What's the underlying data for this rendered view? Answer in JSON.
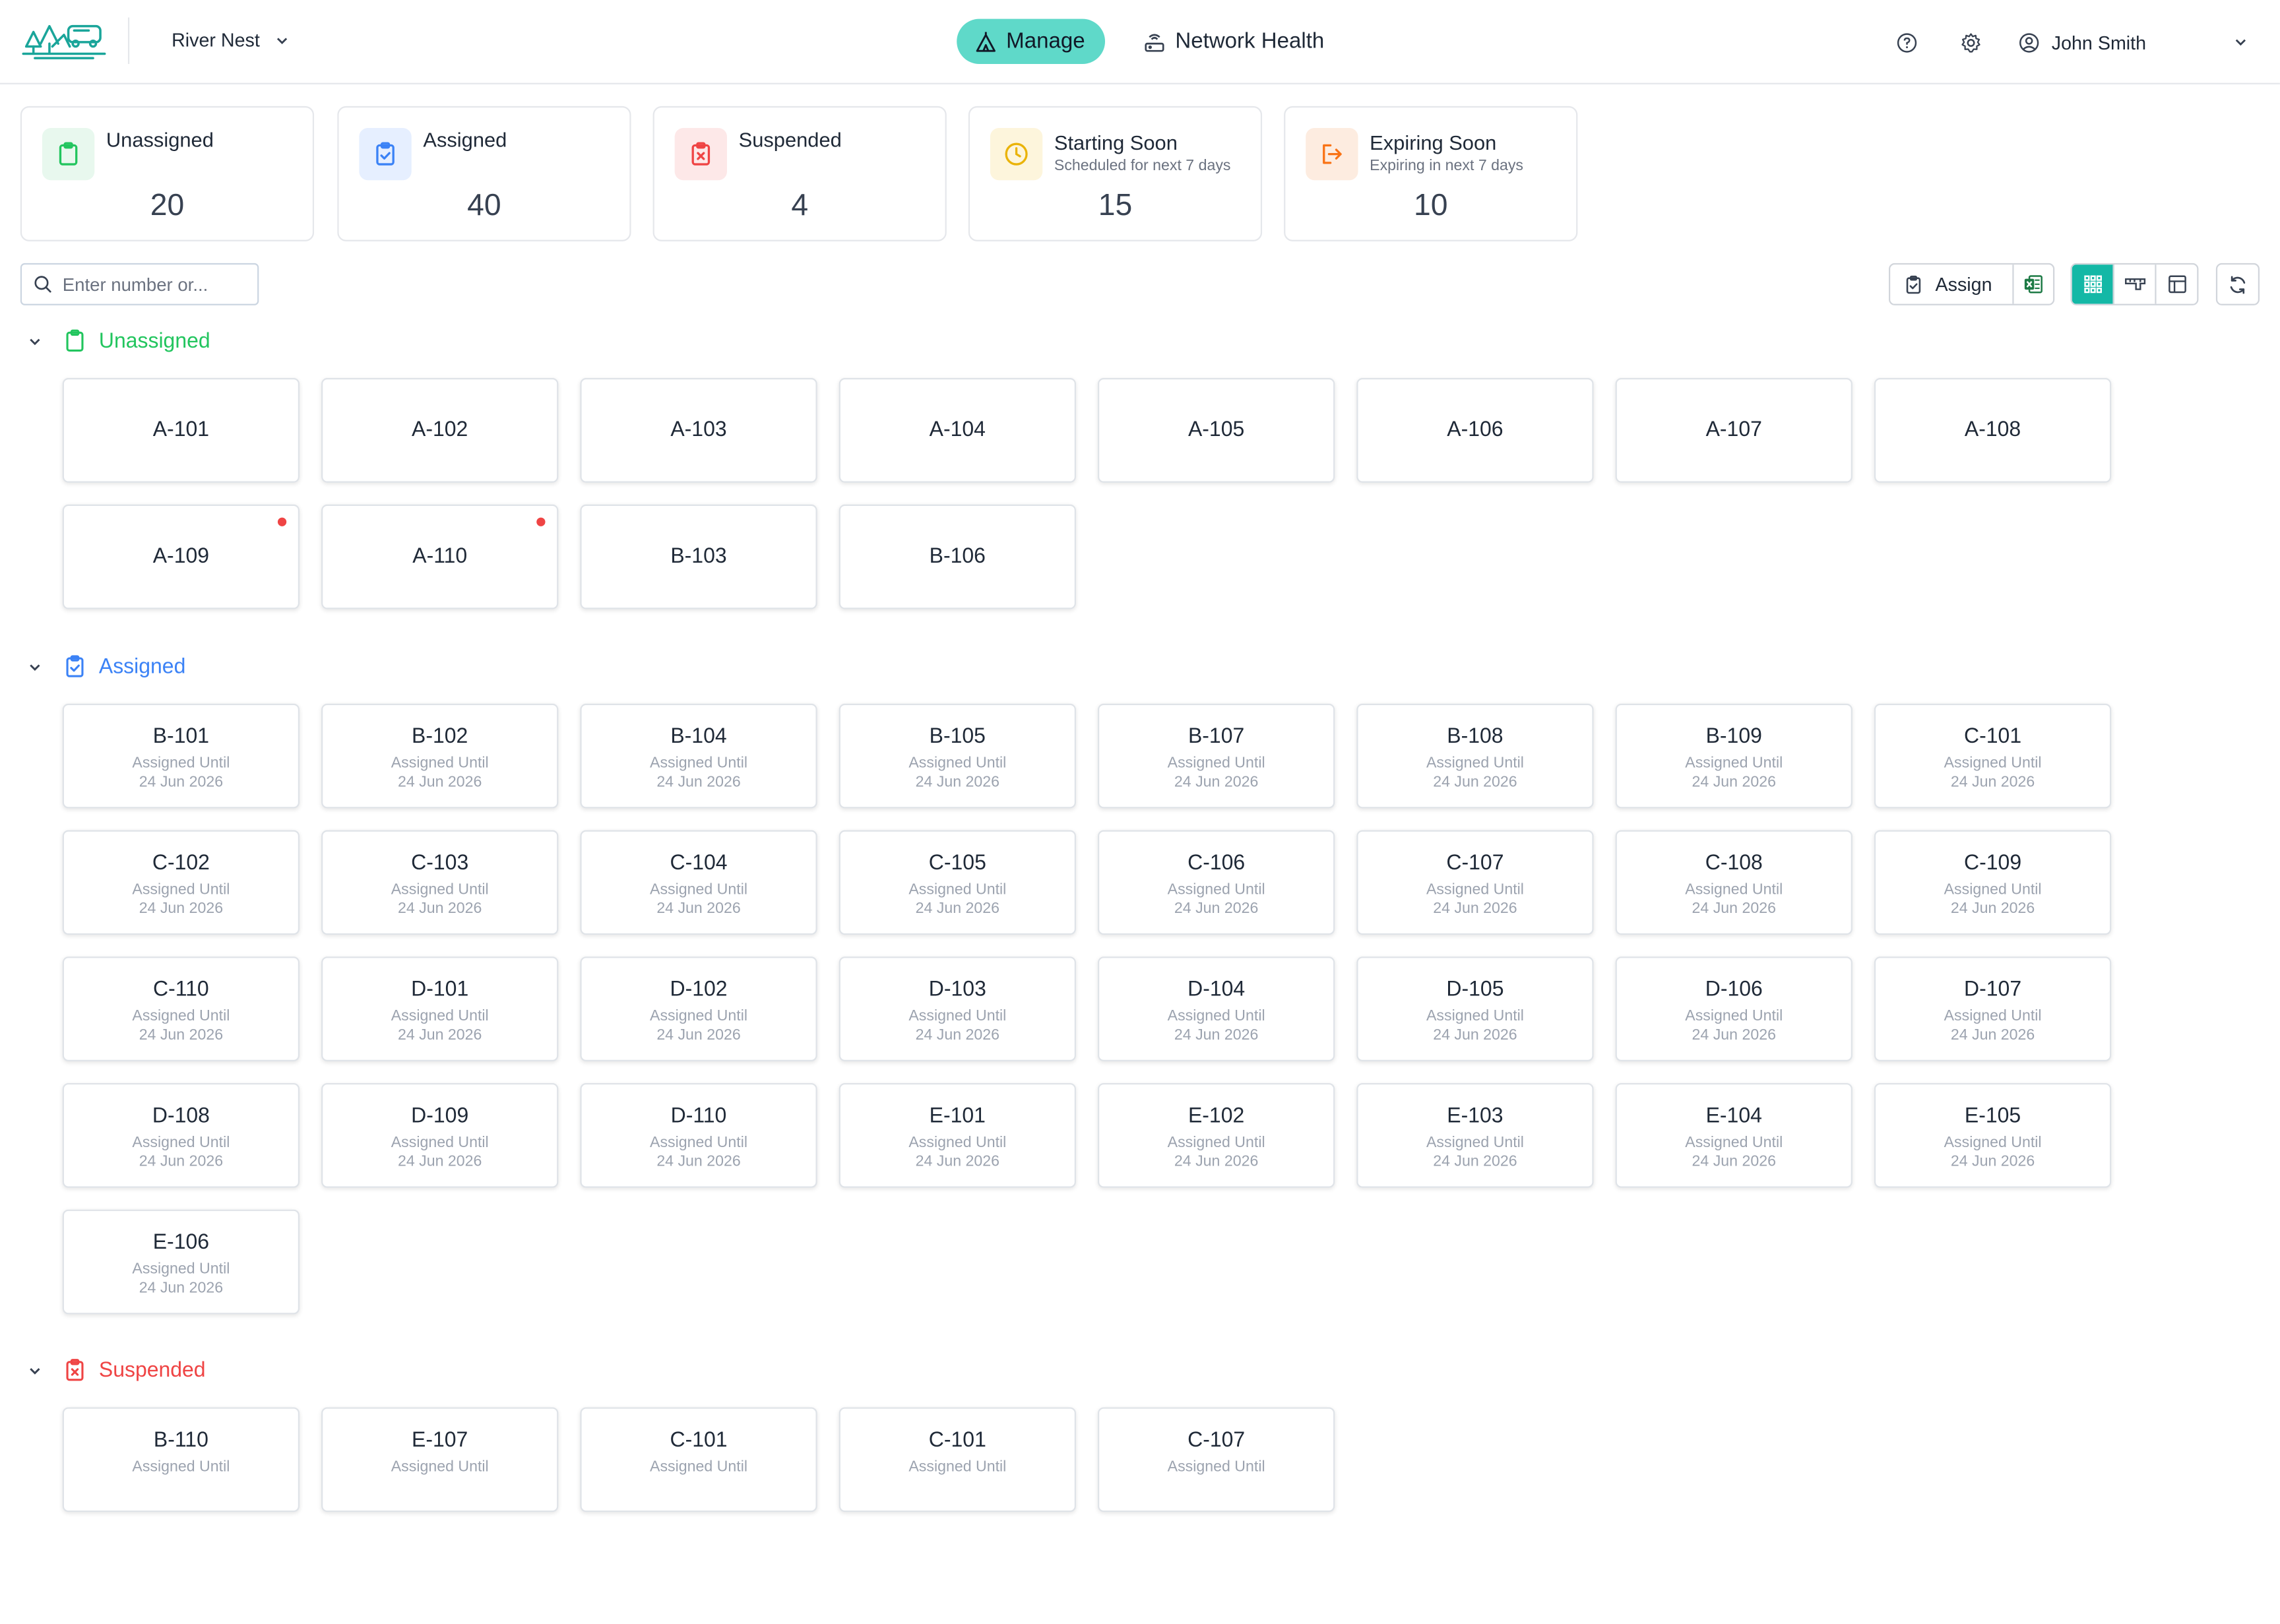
{
  "header": {
    "property": "River Nest",
    "nav": [
      {
        "label": "Manage",
        "active": true,
        "icon": "tent-icon"
      },
      {
        "label": "Network Health",
        "active": false,
        "icon": "router-icon"
      }
    ],
    "user": "John Smith"
  },
  "stats": [
    {
      "title": "Unassigned",
      "sub": "",
      "count": "20",
      "color": "#22c55e",
      "bg": "#e8f8ee",
      "icon": "clipboard-icon"
    },
    {
      "title": "Assigned",
      "sub": "",
      "count": "40",
      "color": "#3b82f6",
      "bg": "#e6efff",
      "icon": "clipboard-check-icon"
    },
    {
      "title": "Suspended",
      "sub": "",
      "count": "4",
      "color": "#ef4444",
      "bg": "#fde8e8",
      "icon": "clipboard-x-icon"
    },
    {
      "title": "Starting Soon",
      "sub": "Scheduled for next 7 days",
      "count": "15",
      "color": "#eab308",
      "bg": "#fdf5dc",
      "icon": "clock-icon"
    },
    {
      "title": "Expiring Soon",
      "sub": "Expiring in next 7 days",
      "count": "10",
      "color": "#f97316",
      "bg": "#fdece0",
      "icon": "exit-icon"
    }
  ],
  "toolbar": {
    "search_placeholder": "Enter number or...",
    "assign_label": "Assign"
  },
  "sections": {
    "unassigned": {
      "title": "Unassigned",
      "color": "#22c55e",
      "tiles": [
        {
          "name": "A-101",
          "dot": false
        },
        {
          "name": "A-102",
          "dot": false
        },
        {
          "name": "A-103",
          "dot": false
        },
        {
          "name": "A-104",
          "dot": false
        },
        {
          "name": "A-105",
          "dot": false
        },
        {
          "name": "A-106",
          "dot": false
        },
        {
          "name": "A-107",
          "dot": false
        },
        {
          "name": "A-108",
          "dot": false
        },
        {
          "name": "A-109",
          "dot": true
        },
        {
          "name": "A-110",
          "dot": true
        },
        {
          "name": "B-103",
          "dot": false
        },
        {
          "name": "B-106",
          "dot": false
        }
      ]
    },
    "assigned": {
      "title": "Assigned",
      "color": "#3b82f6",
      "sub_label": "Assigned Until",
      "sub_date": "24 Jun 2026",
      "tiles": [
        "B-101",
        "B-102",
        "B-104",
        "B-105",
        "B-107",
        "B-108",
        "B-109",
        "C-101",
        "C-102",
        "C-103",
        "C-104",
        "C-105",
        "C-106",
        "C-107",
        "C-108",
        "C-109",
        "C-110",
        "D-101",
        "D-102",
        "D-103",
        "D-104",
        "D-105",
        "D-106",
        "D-107",
        "D-108",
        "D-109",
        "D-110",
        "E-101",
        "E-102",
        "E-103",
        "E-104",
        "E-105",
        "E-106"
      ]
    },
    "suspended": {
      "title": "Suspended",
      "color": "#ef4444",
      "sub_label": "Assigned Until",
      "tiles": [
        "B-110",
        "E-107",
        "C-101",
        "C-101",
        "C-107"
      ]
    }
  }
}
